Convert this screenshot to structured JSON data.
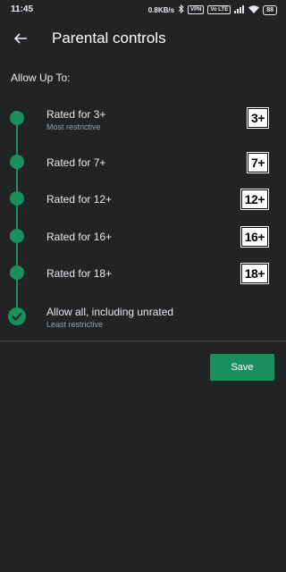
{
  "status_bar": {
    "time": "11:45",
    "speed": "0.8KB/s",
    "vpn": "VPN",
    "volte": "Vo LTE",
    "battery": "88"
  },
  "app_bar": {
    "title": "Parental controls",
    "back_icon": "arrow-left-icon"
  },
  "subtitle": "Allow Up To:",
  "options": [
    {
      "label": "Rated for 3+",
      "sub": "Most restrictive",
      "badge": "3+"
    },
    {
      "label": "Rated for 7+",
      "sub": "",
      "badge": "7+"
    },
    {
      "label": "Rated for 12+",
      "sub": "",
      "badge": "12+"
    },
    {
      "label": "Rated for 16+",
      "sub": "",
      "badge": "16+"
    },
    {
      "label": "Rated for 18+",
      "sub": "",
      "badge": "18+"
    },
    {
      "label": "Allow all, including unrated",
      "sub": "Least restrictive",
      "badge": "",
      "selected": true
    }
  ],
  "save_label": "Save",
  "colors": {
    "accent": "#1a8f5f",
    "background": "#212325",
    "text": "#e8eaed",
    "muted": "#9aa0a6"
  }
}
